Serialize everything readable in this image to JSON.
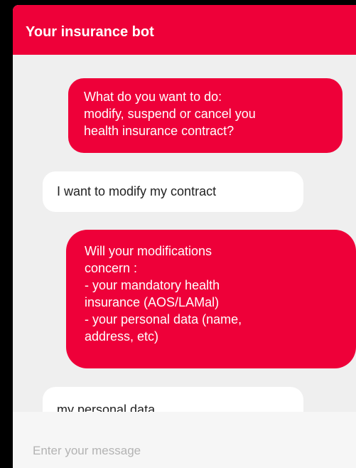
{
  "header": {
    "title": "Your insurance bot"
  },
  "messages": [
    {
      "sender": "bot",
      "lines": [
        "What do you want to do:",
        "modify, suspend or cancel you",
        "health insurance contract?"
      ]
    },
    {
      "sender": "user",
      "lines": [
        "I want to modify my contract"
      ]
    },
    {
      "sender": "bot",
      "lines": [
        "Will your modifications",
        "concern :",
        "- your mandatory health",
        "insurance (AOS/LAMal)",
        "- your personal data (name,",
        "address, etc)"
      ]
    },
    {
      "sender": "user",
      "lines": [
        "my personal data"
      ]
    }
  ],
  "input": {
    "placeholder": "Enter your message",
    "value": ""
  },
  "colors": {
    "accent": "#ee0039",
    "background": "#efefef",
    "user_bubble": "#ffffff"
  }
}
